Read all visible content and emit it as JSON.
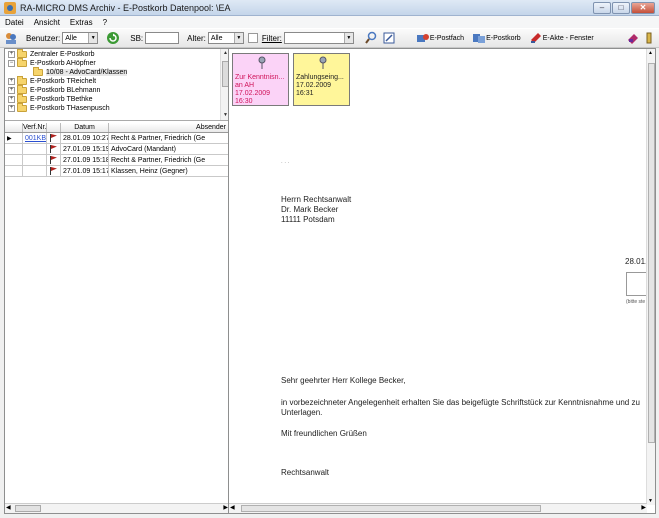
{
  "window": {
    "title": "RA-MICRO DMS Archiv - E-Postkorb  Datenpool: \\EA"
  },
  "menu": [
    "Datei",
    "Ansicht",
    "Extras",
    "?"
  ],
  "toolbar": {
    "benutzer_label": "Benutzer:",
    "benutzer_value": "Alle",
    "sb_label": "SB:",
    "sb_value": "",
    "alter_label": "Alter:",
    "alter_value": "Alle",
    "filter_label": "Filter:",
    "filter_value": "",
    "epostfach_label": "E-Postfach",
    "epostkorb_label": "E-Postkorb",
    "eakte_label": "E-Akte - Fenster"
  },
  "tree": [
    {
      "label": "Zentraler E-Postkorb",
      "exp": "+"
    },
    {
      "label": "E-Postkorb AHöpfner",
      "exp": "−"
    },
    {
      "label": "10/08 - AdvoCard/Klassen",
      "exp": ""
    },
    {
      "label": "E-Postkorb TReichelt",
      "exp": "+"
    },
    {
      "label": "E-Postkorb BLehmann",
      "exp": "+"
    },
    {
      "label": "E-Postkorb TBethke",
      "exp": "+"
    },
    {
      "label": "E-Postkorb THasenpusch",
      "exp": "+"
    }
  ],
  "grid": {
    "headers": {
      "nr": "Verf.Nr.",
      "date": "Datum",
      "sender": "Absender"
    },
    "rows": [
      {
        "nr": "001KB",
        "date": "28.01.09 10:27",
        "sender": "Recht & Partner, Friedrich (Ge"
      },
      {
        "nr": "",
        "date": "27.01.09 15:19",
        "sender": "AdvoCard (Mandant)"
      },
      {
        "nr": "",
        "date": "27.01.09 15:18",
        "sender": "Recht & Partner, Friedrich (Ge"
      },
      {
        "nr": "",
        "date": "27.01.09 15:17",
        "sender": "Klassen, Heinz (Gegner)"
      }
    ]
  },
  "notes": [
    {
      "line1": "Zur Kenntnisn...",
      "line2": "an AH",
      "date": "17.02.2009",
      "time": "16:30"
    },
    {
      "line1": "Zahlungseing...",
      "line2": "",
      "date": "17.02.2009",
      "time": "16:31"
    }
  ],
  "document": {
    "dots": ". . .",
    "addr1": "Herrn Rechtsanwalt",
    "addr2": "Dr. Mark Becker",
    "addr3": "11111 Potsdam",
    "date": "28.01.:",
    "box_caption": "(bitte ste",
    "salutation": "Sehr geehrter Herr Kollege Becker,",
    "body1": "in vorbezeichneter Angelegenheit erhalten Sie das beigefügte Schriftstück zur Kenntnisnahme und zu",
    "body2": "Unterlagen.",
    "closing": "Mit freundlichen Grüßen",
    "signature": "Rechtsanwalt"
  },
  "colors": {
    "note_pink": "#fbd3f7",
    "note_yellow": "#fff69a",
    "link": "#2a4fd1",
    "flag": "#b0231f"
  }
}
